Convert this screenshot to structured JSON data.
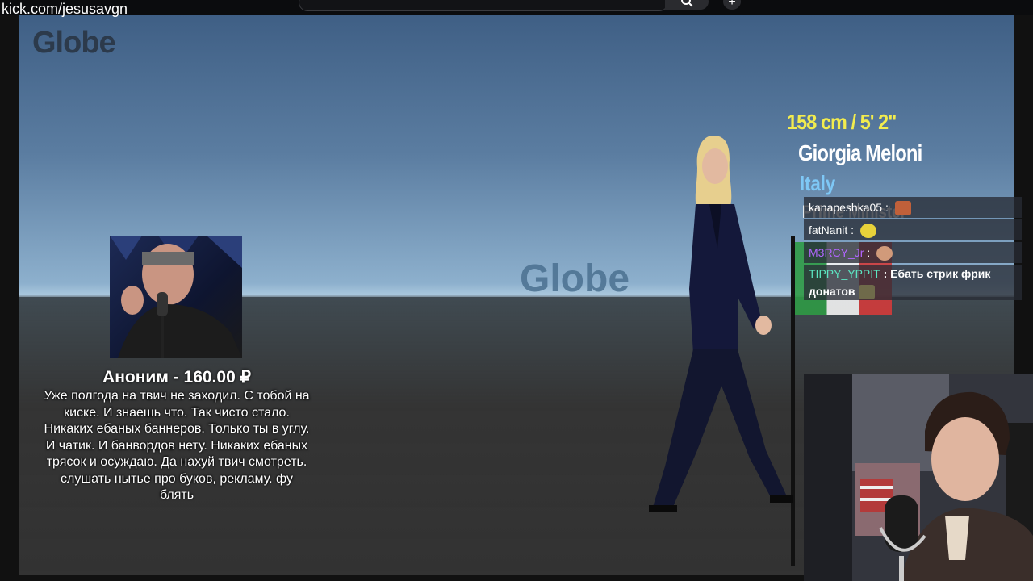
{
  "browser": {
    "url_overlay": "kick.com/jesusavgn",
    "search_placeholder": "",
    "add_label": "+"
  },
  "stream": {
    "logo_corner": "Globe",
    "logo_center": "Globe",
    "person": {
      "height": "158 cm / 5' 2\"",
      "name": "Giorgia Meloni",
      "country": "Italy",
      "role": "Prime Minister"
    },
    "donation": {
      "title": "Аноним - 160.00 ₽",
      "message": "Уже полгода на твич не заходил. С тобой на киске. И знаешь что. Так чисто стало. Никаких ебаных баннеров. Только ты в углу. И чатик. И банвордов нету. Никаких ебаных трясок и осуждаю. Да нахуй твич смотреть. слушать нытье про буков, рекламу. фу блять"
    }
  },
  "chat": {
    "messages": [
      {
        "user": "kanapeshka05",
        "user_color": "#ffffff",
        "text": "",
        "emote": "laughing-face-emote"
      },
      {
        "user": "fatNanit",
        "user_color": "#ffffff",
        "text": "",
        "emote": "duck-emote"
      },
      {
        "user": "M3RCY_Jr",
        "user_color": "#b266ff",
        "text": "",
        "emote": "face-emote"
      },
      {
        "user": "TIPPY_YPPIT",
        "user_color": "#5ce6c2",
        "text": "Ебать стрик фрик донатов",
        "emote": "creature-emote"
      }
    ],
    "separator": " : "
  },
  "colors": {
    "height_yellow": "#f2ec4e",
    "country_blue": "#7ec8f6",
    "logo_dark": "#2c3a4b",
    "logo_center": "#4a7090"
  }
}
